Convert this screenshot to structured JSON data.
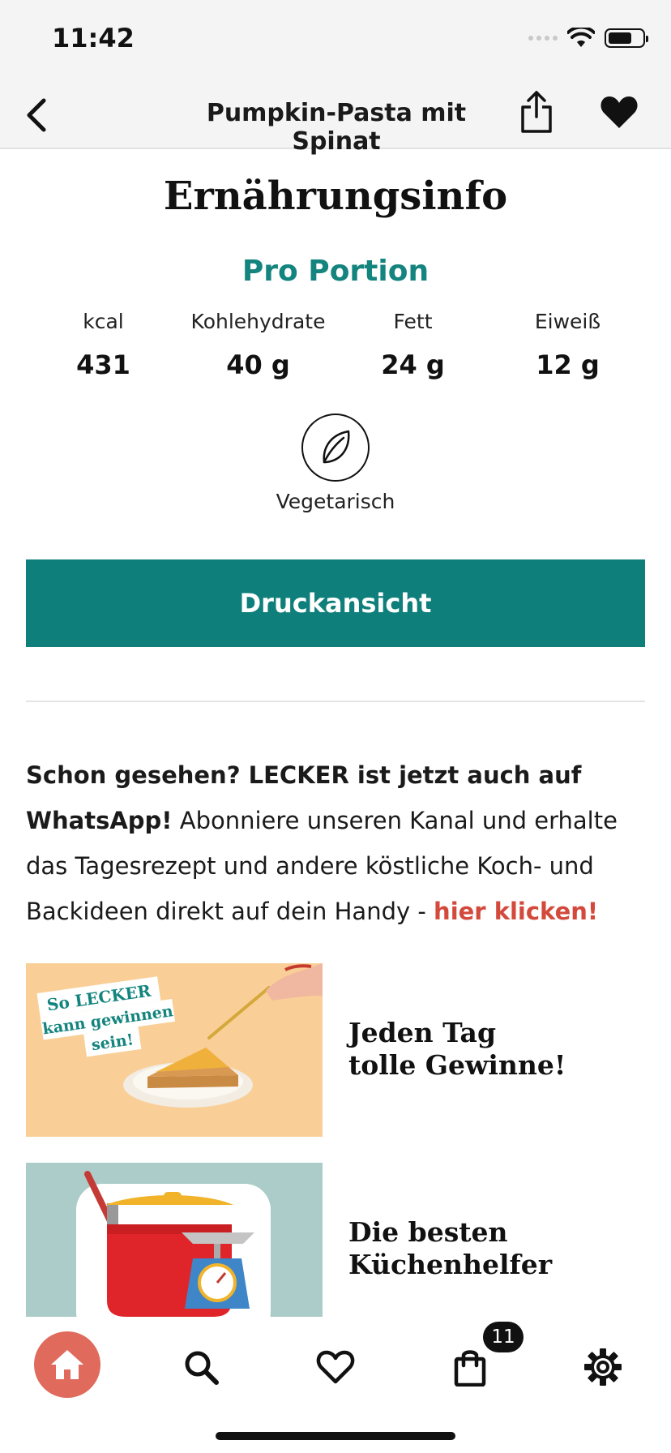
{
  "status": {
    "time": "11:42"
  },
  "nav": {
    "title": "Pumpkin-Pasta mit Spinat"
  },
  "nutrition": {
    "section_title": "Ernährungsinfo",
    "subtitle": "Pro Portion",
    "items": [
      {
        "label": "kcal",
        "value": "431"
      },
      {
        "label": "Kohlehydrate",
        "value": "40 g"
      },
      {
        "label": "Fett",
        "value": "24 g"
      },
      {
        "label": "Eiweiß",
        "value": "12 g"
      }
    ],
    "diet_label": "Vegetarisch"
  },
  "print_button": "Druckansicht",
  "promo": {
    "bold_text": "Schon gesehen? LECKER ist jetzt auch auf WhatsApp!",
    "text": " Abonniere unseren Kanal und erhalte das Tagesrezept und andere köstliche Koch- und Backideen direkt auf dein Handy - ",
    "link": "hier klicken!"
  },
  "cards": [
    {
      "title_line1": "Jeden Tag",
      "title_line2": "tolle Gewinne!",
      "image_text": [
        "So LECKER",
        "kann gewinnen",
        "sein!"
      ]
    },
    {
      "title_line1": "Die besten",
      "title_line2": "Küchenhelfer"
    }
  ],
  "tabbar": {
    "items": [
      "home-icon",
      "search-icon",
      "heart-icon",
      "bag-icon",
      "gear-icon"
    ],
    "cart_count": "11"
  },
  "colors": {
    "accent": "#0f7f7b",
    "link": "#d3493b",
    "home": "#e06a5c"
  }
}
